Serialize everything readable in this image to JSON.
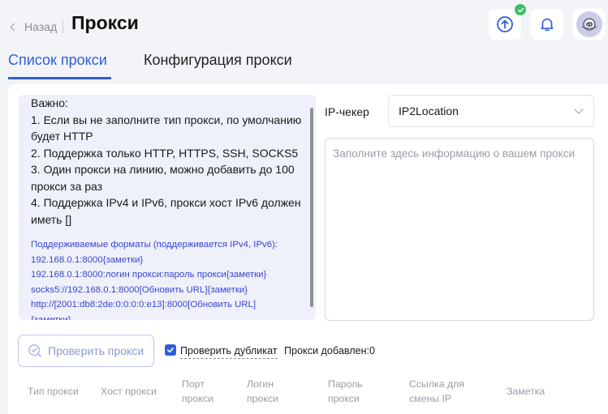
{
  "header": {
    "back_label": "Назад",
    "title": "Прокси"
  },
  "tabs": [
    {
      "label": "Список прокси",
      "active": true
    },
    {
      "label": "Конфигурация прокси",
      "active": false
    }
  ],
  "info": {
    "important": "Важно:",
    "rules": [
      "1. Если вы не заполните тип прокси, по умолчанию будет HTTP",
      "2. Поддержка только HTTP, HTTPS, SSH, SOCKS5",
      "3. Один прокси на линию, можно добавить до 100 прокси за раз",
      "4. Поддержка IPv4 и IPv6, прокси хост IPv6 должен иметь []"
    ],
    "formats": [
      "Поддерживаемые форматы (поддерживается IPv4, IPv6):",
      "192.168.0.1:8000{заметки}",
      "192.168.0.1:8000:логин прокси:пароль прокси{заметки}",
      "socks5://192.168.0.1:8000[Обновить URL]{заметки}",
      "http://[2001:db8:2de:0:0:0:0:e13]:8000[Обновить URL]",
      "{заметки}"
    ]
  },
  "ip_checker": {
    "label": "IP-чекер",
    "selected": "IP2Location"
  },
  "proxy_input": {
    "placeholder": "Заполните здесь информацию о вашем прокси"
  },
  "actions": {
    "check_button": "Проверить прокси",
    "dup_check_label": "Проверить дубликат",
    "dup_check_checked": true,
    "added_label": "Прокси добавлен:",
    "added_count": "0"
  },
  "table": {
    "columns": [
      "Тип прокси",
      "Хост прокси",
      "Порт прокси",
      "Логин прокси",
      "Пароль прокси",
      "Ссылка для смены IP",
      "Заметка"
    ]
  },
  "colors": {
    "accent": "#2f5fd8",
    "success_badge": "#3fbf6a",
    "info_bg": "#eef0fa",
    "format_text": "#3a45d2"
  },
  "icons": {
    "sync": "sync-upload-icon",
    "notifications": "bell-icon",
    "avatar": "user-avatar"
  }
}
